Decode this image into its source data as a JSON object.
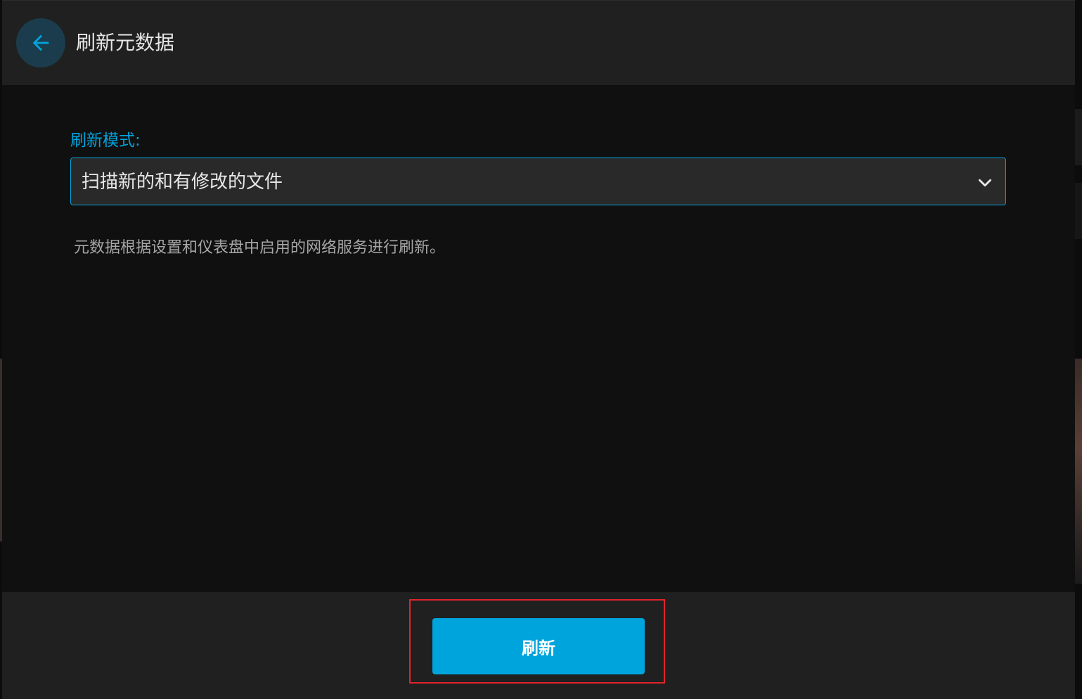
{
  "dialog": {
    "title": "刷新元数据",
    "back_icon": "arrow-left-icon"
  },
  "form": {
    "refresh_mode_label": "刷新模式:",
    "refresh_mode_value": "扫描新的和有修改的文件",
    "refresh_mode_description": "元数据根据设置和仪表盘中启用的网络服务进行刷新。"
  },
  "footer": {
    "refresh_button_label": "刷新"
  },
  "colors": {
    "accent": "#00a4dc",
    "highlight": "#e0242c",
    "header_bg": "#202020",
    "content_bg": "#101010"
  }
}
